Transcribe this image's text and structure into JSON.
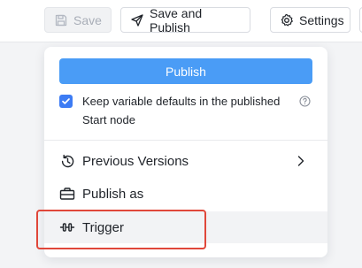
{
  "toolbar": {
    "save_label": "Save",
    "save_publish_label": "Save and Publish",
    "settings_label": "Settings"
  },
  "publish_menu": {
    "publish_button_label": "Publish",
    "keep_defaults_label": "Keep variable defaults in the published Start node",
    "keep_defaults_checked": true,
    "items": [
      {
        "label": "Previous Versions",
        "icon": "history-icon",
        "has_submenu": true
      },
      {
        "label": "Publish as",
        "icon": "toolbox-icon",
        "has_submenu": false
      },
      {
        "label": "Trigger",
        "icon": "trigger-icon",
        "has_submenu": false,
        "hovered": true
      }
    ]
  },
  "colors": {
    "primary": "#4a9cf6",
    "checkbox": "#3d7cf4",
    "highlight_outline": "#e0473a"
  }
}
